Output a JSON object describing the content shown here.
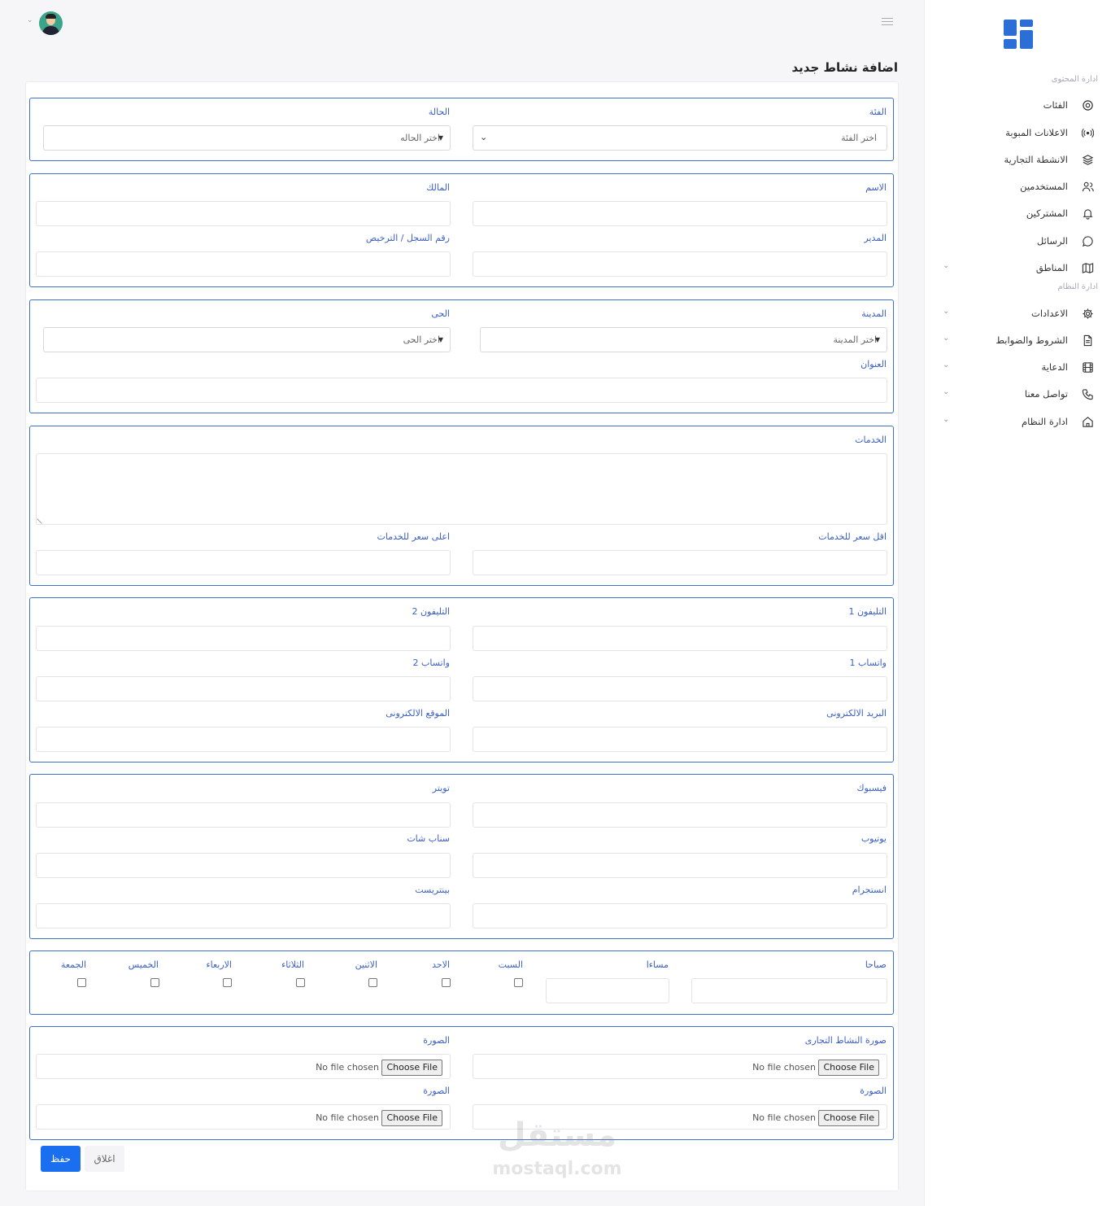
{
  "header": {
    "page_title": "اضافة نشاط جديد"
  },
  "sidebar": {
    "section_content": "ادارة المحتوى",
    "section_system": "ادارة النظام",
    "items": [
      {
        "label": "الفئات",
        "icon": "at-icon"
      },
      {
        "label": "الاعلانات المبوبة",
        "icon": "broadcast-icon"
      },
      {
        "label": "الانشطة التجارية",
        "icon": "layers-icon"
      },
      {
        "label": "المستخدمين",
        "icon": "users-icon"
      },
      {
        "label": "المشتركين",
        "icon": "bell-icon"
      },
      {
        "label": "الرسائل",
        "icon": "message-icon"
      },
      {
        "label": "المناطق",
        "icon": "map-icon"
      },
      {
        "label": "الاعدادات",
        "icon": "gear-icon"
      },
      {
        "label": "الشروط والضوابط",
        "icon": "document-icon"
      },
      {
        "label": "الدعاية",
        "icon": "film-icon"
      },
      {
        "label": "تواصل معنا",
        "icon": "phone-icon"
      },
      {
        "label": "ادارة النظام",
        "icon": "home-icon"
      }
    ]
  },
  "form": {
    "category_label": "الفئة",
    "category_placeholder": "اختر الفئة",
    "status_label": "الحالة",
    "status_placeholder": "اختر الحاله",
    "name_label": "الاسم",
    "owner_label": "المالك",
    "manager_label": "المدير",
    "license_label": "رقم السجل / الترخيص",
    "city_label": "المدينة",
    "city_placeholder": "اختر المدينة",
    "district_label": "الحى",
    "district_placeholder": "اختر الحى",
    "address_label": "العنوان",
    "services_label": "الخدمات",
    "min_price_label": "اقل سعر للخدمات",
    "max_price_label": "اعلى سعر للخدمات",
    "phone1_label": "التليفون 1",
    "phone2_label": "التليفون 2",
    "whatsapp1_label": "واتساب 1",
    "whatsapp2_label": "واتساب 2",
    "email_label": "البريد الالكترونى",
    "website_label": "الموقع الالكترونى",
    "facebook_label": "فيسبوك",
    "twitter_label": "تويتر",
    "youtube_label": "يوتيوب",
    "snapchat_label": "سناب شات",
    "instagram_label": "انستجرام",
    "pinterest_label": "بينتريست",
    "morning_label": "صباحا",
    "evening_label": "مساءا",
    "days": [
      "السبت",
      "الاحد",
      "الاثنين",
      "الثلاثاء",
      "الاربعاء",
      "الخميس",
      "الجمعة"
    ],
    "business_image_label": "صورة النشاط التجارى",
    "image_label": "الصورة",
    "choose_file": "Choose File",
    "no_file": "No file chosen",
    "save_label": "حفظ",
    "close_label": "اغلاق"
  },
  "watermark": {
    "arabic": "مستقل",
    "latin": "mostaql.com"
  }
}
